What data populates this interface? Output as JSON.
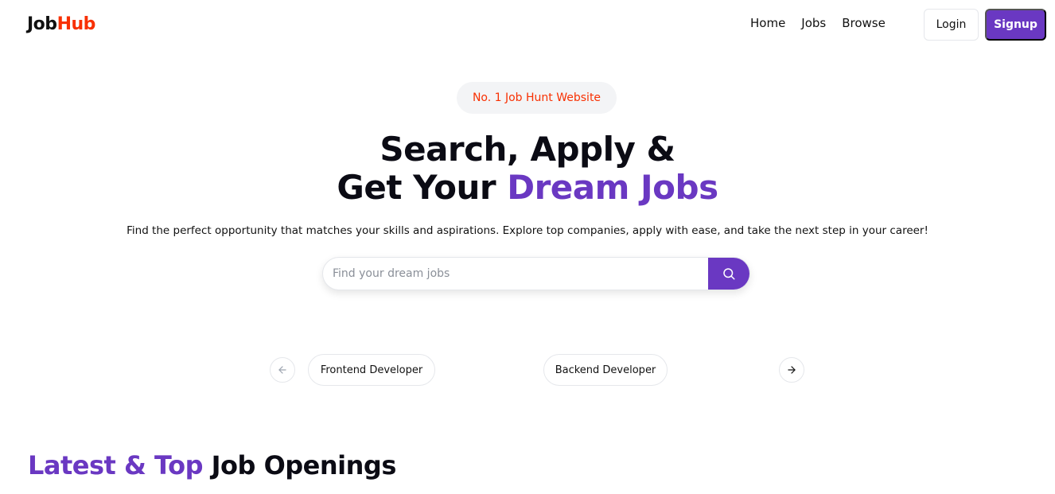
{
  "navbar": {
    "logo_part1": "Job",
    "logo_part2": "Hub",
    "links": [
      "Home",
      "Jobs",
      "Browse"
    ],
    "login_label": "Login",
    "signup_label": "Signup"
  },
  "hero": {
    "badge": "No. 1 Job Hunt Website",
    "headline_line1": "Search, Apply &",
    "headline_line2_plain": "Get Your ",
    "headline_line2_accent": "Dream Jobs",
    "subtext": "Find the perfect opportunity that matches your skills and aspirations. Explore top companies, apply with ease, and take the next step in your career!"
  },
  "search": {
    "placeholder": "Find your dream jobs",
    "value": "",
    "button_icon": "search-icon"
  },
  "carousel": {
    "prev_icon": "arrow-left-icon",
    "next_icon": "arrow-right-icon",
    "items": [
      "Frontend Developer",
      "Backend Developer"
    ]
  },
  "latest_section": {
    "title_accent": "Latest & Top",
    "title_plain": " Job Openings"
  },
  "colors": {
    "brand_purple": "#6a38c2",
    "brand_red": "#f83002"
  }
}
